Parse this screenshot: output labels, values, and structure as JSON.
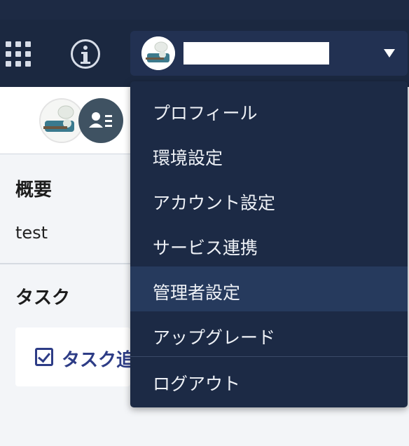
{
  "header": {
    "apps_icon": "grid-icon",
    "info_icon": "info-icon",
    "account": {
      "caret_icon": "caret-down-icon"
    }
  },
  "profile": {
    "contact_icon": "contact-card-icon"
  },
  "summary": {
    "heading": "概要",
    "text": "test"
  },
  "tasks": {
    "heading": "タスク",
    "add_label": "タスク追加",
    "check_icon": "checkbox-icon"
  },
  "menu": {
    "items": [
      "プロフィール",
      "環境設定",
      "アカウント設定",
      "サービス連携",
      "管理者設定",
      "アップグレード",
      "ログアウト"
    ],
    "highlighted": "管理者設定"
  },
  "colors": {
    "header_bg": "#1b2840",
    "menu_bg": "#1c2a45",
    "menu_highlight": "#263a5d",
    "accent_blue": "#2d3c86"
  }
}
